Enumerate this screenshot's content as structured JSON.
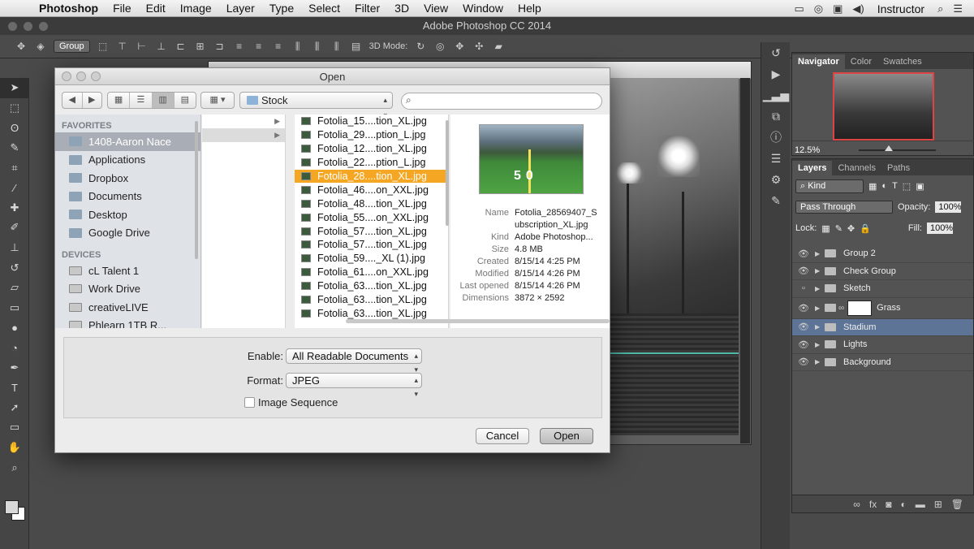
{
  "menubar": {
    "app": "Photoshop",
    "items": [
      "File",
      "Edit",
      "Image",
      "Layer",
      "Type",
      "Select",
      "Filter",
      "3D",
      "View",
      "Window",
      "Help"
    ],
    "user": "Instructor",
    "status_icons": [
      "battery-icon",
      "sync-icon",
      "display-icon",
      "volume-icon",
      "search-icon",
      "list-icon"
    ]
  },
  "app_title": "Adobe Photoshop CC 2014",
  "options_bar": {
    "auto_select_value": "Group",
    "mode_label": "3D Mode:"
  },
  "dialog": {
    "title": "Open",
    "location": "Stock",
    "search_placeholder": "",
    "sidebar": {
      "favorites_header": "FAVORITES",
      "favorites": [
        "1408-Aaron Nace",
        "Applications",
        "Dropbox",
        "Documents",
        "Desktop",
        "Google Drive"
      ],
      "devices_header": "DEVICES",
      "devices": [
        "cL Talent 1",
        "Work Drive",
        "creativeLIVE",
        "Phlearn 1TB R..."
      ]
    },
    "files": [
      "Fotolia_15....tion_XL.jpg",
      "Fotolia_29....ption_L.jpg",
      "Fotolia_12....tion_XL.jpg",
      "Fotolia_22....ption_L.jpg",
      "Fotolia_28....tion_XL.jpg",
      "Fotolia_46....on_XXL.jpg",
      "Fotolia_48....tion_XL.jpg",
      "Fotolia_55....on_XXL.jpg",
      "Fotolia_57....tion_XL.jpg",
      "Fotolia_57....tion_XL.jpg",
      "Fotolia_59...._XL (1).jpg",
      "Fotolia_61....on_XXL.jpg",
      "Fotolia_63....tion_XL.jpg",
      "Fotolia_63....tion_XL.jpg",
      "Fotolia_63....tion_XL.jpg"
    ],
    "selected_file_index": 4,
    "preview": {
      "name_label": "Name",
      "name": "Fotolia_28569407_S ubscription_XL.jpg",
      "kind_label": "Kind",
      "kind": "Adobe Photoshop...",
      "size_label": "Size",
      "size": "4.8 MB",
      "created_label": "Created",
      "created": "8/15/14 4:25 PM",
      "modified_label": "Modified",
      "modified": "8/15/14 4:26 PM",
      "opened_label": "Last opened",
      "opened": "8/15/14 4:26 PM",
      "dims_label": "Dimensions",
      "dims": "3872 × 2592",
      "yard_number": "50"
    },
    "enable_label": "Enable:",
    "enable_value": "All Readable Documents",
    "format_label": "Format:",
    "format_value": "JPEG",
    "sequence_label": "Image Sequence",
    "cancel": "Cancel",
    "open": "Open"
  },
  "navigator": {
    "tabs": [
      "Navigator",
      "Color",
      "Swatches"
    ],
    "zoom": "12.5%"
  },
  "layers_panel": {
    "tabs": [
      "Layers",
      "Channels",
      "Paths"
    ],
    "filter": "Kind",
    "blend_mode": "Pass Through",
    "opacity_label": "Opacity:",
    "opacity": "100%",
    "lock_label": "Lock:",
    "fill_label": "Fill:",
    "fill": "100%",
    "layers": [
      {
        "name": "Group 2",
        "visible": true,
        "type": "group"
      },
      {
        "name": "Check Group",
        "visible": true,
        "type": "group"
      },
      {
        "name": "Sketch",
        "visible": false,
        "type": "group"
      },
      {
        "name": "Grass",
        "visible": true,
        "type": "group-mask"
      },
      {
        "name": "Stadium",
        "visible": true,
        "type": "group",
        "selected": true
      },
      {
        "name": "Lights",
        "visible": true,
        "type": "group"
      },
      {
        "name": "Background",
        "visible": true,
        "type": "group"
      }
    ]
  }
}
